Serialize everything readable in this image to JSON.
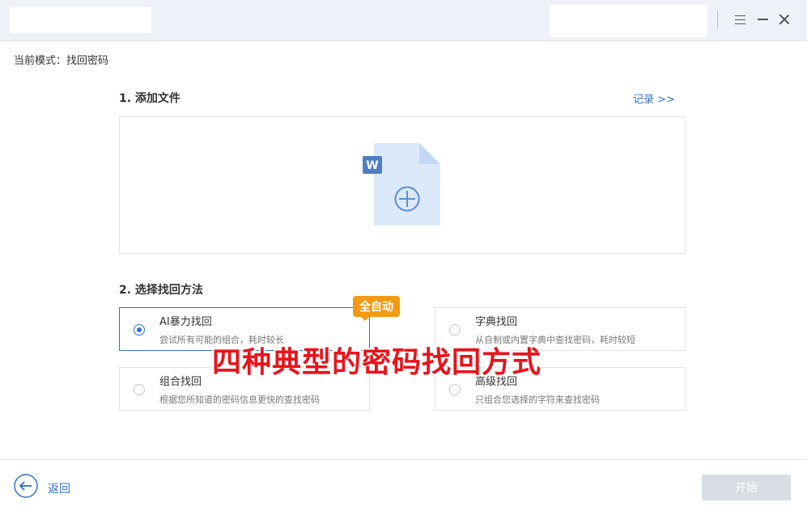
{
  "window": {
    "icons": {
      "menu": "menu-icon",
      "minimize": "minimize-icon",
      "close": "close-icon"
    }
  },
  "mode": {
    "label": "当前模式：找回密码"
  },
  "step1": {
    "title": "1. 添加文件",
    "records_link": "记录 >>",
    "dropzone": {
      "badge_letter": "W",
      "icon": "word-document-add-icon"
    }
  },
  "step2": {
    "title": "2. 选择找回方法",
    "badge": "全自动",
    "options": [
      {
        "title": "AI暴力找回",
        "desc": "尝试所有可能的组合，耗时较长",
        "selected": true
      },
      {
        "title": "字典找回",
        "desc": "从自制或内置字典中查找密码，耗时较短",
        "selected": false
      },
      {
        "title": "组合找回",
        "desc": "根据您所知道的密码信息更快的查找密码",
        "selected": false
      },
      {
        "title": "高级找回",
        "desc": "只组合您选择的字符来查找密码",
        "selected": false
      }
    ]
  },
  "overlay": {
    "caption": "四种典型的密码找回方式"
  },
  "footer": {
    "back_label": "返回",
    "start_label": "开始"
  },
  "colors": {
    "accent": "#2f6fc9",
    "badge": "#f29a12",
    "overlay_text": "#e8141b",
    "start_disabled": "#d9dee6"
  }
}
